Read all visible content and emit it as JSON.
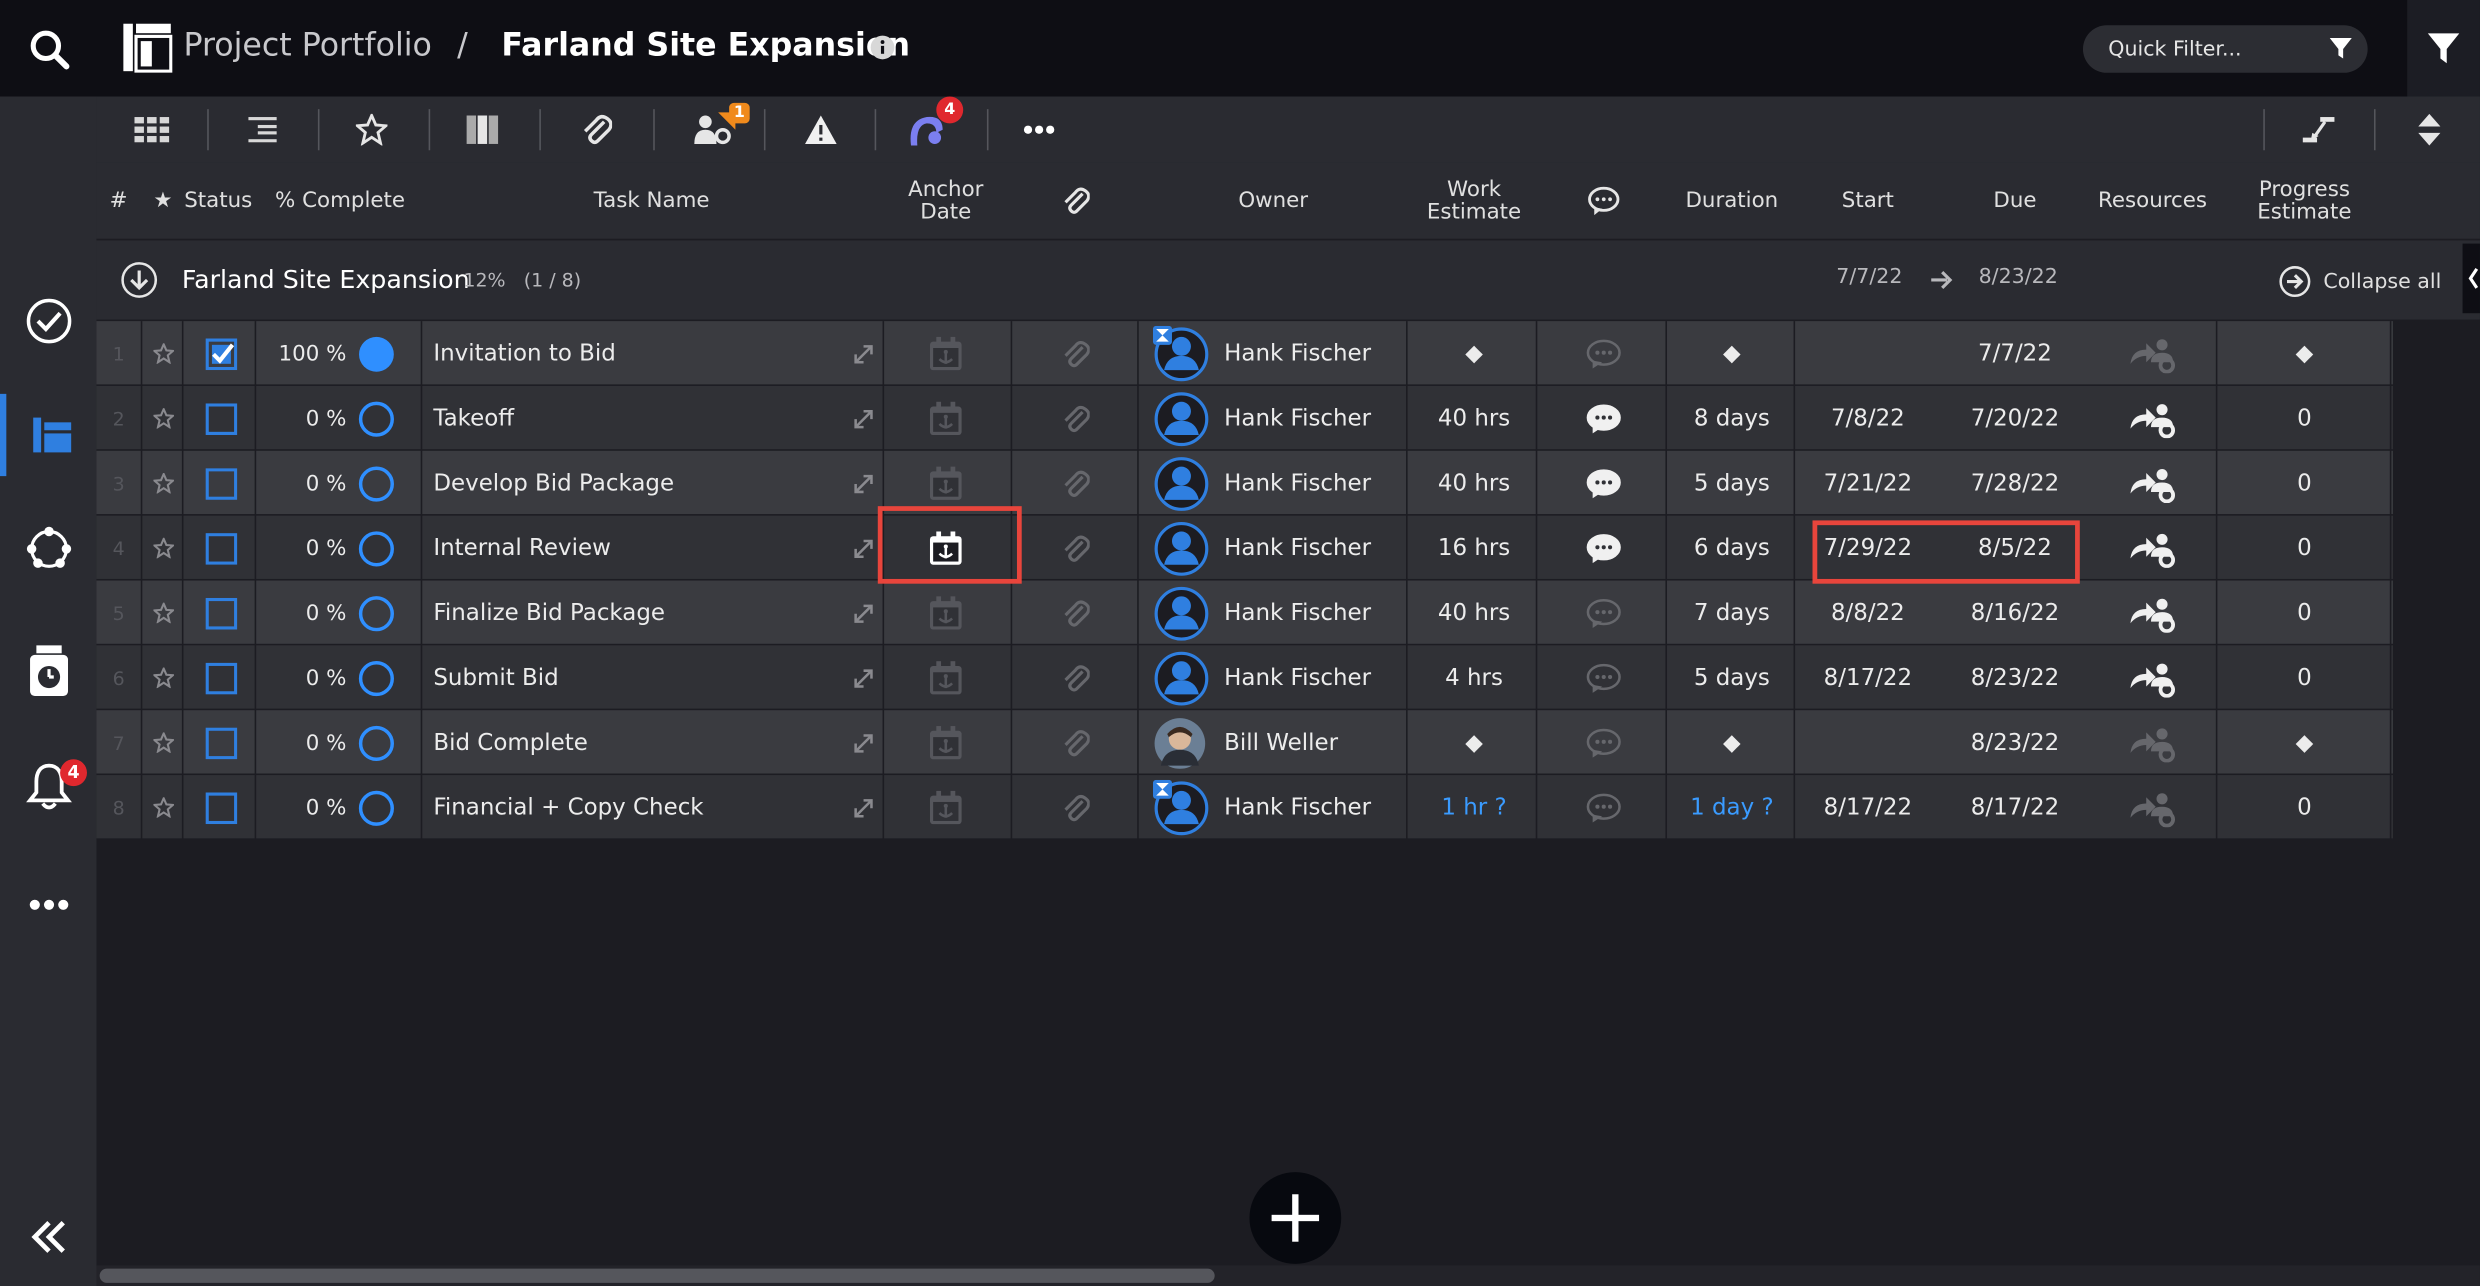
{
  "header": {
    "breadcrumb_root": "Project Portfolio",
    "breadcrumb_separator": "/",
    "title": "Farland Site Expansion",
    "quick_filter_placeholder": "Quick Filter..."
  },
  "rail": {
    "notification_count": "4"
  },
  "toolbar": {
    "resource_badge": "1",
    "collab_badge": "4"
  },
  "columns": {
    "num": "#",
    "star": "★",
    "status": "Status",
    "pct": "% Complete",
    "task": "Task Name",
    "anchor_line1": "Anchor",
    "anchor_line2": "Date",
    "owner": "Owner",
    "work_line1": "Work",
    "work_line2": "Estimate",
    "duration": "Duration",
    "start": "Start",
    "due": "Due",
    "resources": "Resources",
    "progress_line1": "Progress",
    "progress_line2": "Estimate"
  },
  "group": {
    "title": "Farland Site Expansion",
    "meta": "12%   (1 / 8)",
    "start": "7/7/22",
    "due": "8/23/22",
    "collapse_label": "Collapse all"
  },
  "rows": [
    {
      "num": "1",
      "checked": true,
      "pct": "100 %",
      "filled": true,
      "task": "Invitation to Bid",
      "owner": "Hank Fischer",
      "avatar": "timer-person",
      "work": "◆",
      "comment_active": false,
      "duration": "◆",
      "start": "",
      "due": "7/7/22",
      "res_active": false,
      "progress": "◆"
    },
    {
      "num": "2",
      "checked": false,
      "pct": "0 %",
      "filled": false,
      "task": "Takeoff",
      "owner": "Hank Fischer",
      "avatar": "person",
      "work": "40 hrs",
      "comment_active": true,
      "duration": "8 days",
      "start": "7/8/22",
      "due": "7/20/22",
      "res_active": true,
      "progress": "0"
    },
    {
      "num": "3",
      "checked": false,
      "pct": "0 %",
      "filled": false,
      "task": "Develop Bid Package",
      "owner": "Hank Fischer",
      "avatar": "person",
      "work": "40 hrs",
      "comment_active": true,
      "duration": "5 days",
      "start": "7/21/22",
      "due": "7/28/22",
      "res_active": true,
      "progress": "0"
    },
    {
      "num": "4",
      "checked": false,
      "pct": "0 %",
      "filled": false,
      "task": "Internal Review",
      "owner": "Hank Fischer",
      "avatar": "person",
      "work": "16 hrs",
      "comment_active": true,
      "duration": "6 days",
      "start": "7/29/22",
      "due": "8/5/22",
      "res_active": true,
      "progress": "0",
      "anchor_active": true
    },
    {
      "num": "5",
      "checked": false,
      "pct": "0 %",
      "filled": false,
      "task": "Finalize Bid Package",
      "owner": "Hank Fischer",
      "avatar": "person",
      "work": "40 hrs",
      "comment_active": false,
      "duration": "7 days",
      "start": "8/8/22",
      "due": "8/16/22",
      "res_active": true,
      "progress": "0"
    },
    {
      "num": "6",
      "checked": false,
      "pct": "0 %",
      "filled": false,
      "task": "Submit Bid",
      "owner": "Hank Fischer",
      "avatar": "person",
      "work": "4 hrs",
      "comment_active": false,
      "duration": "5 days",
      "start": "8/17/22",
      "due": "8/23/22",
      "res_active": true,
      "progress": "0"
    },
    {
      "num": "7",
      "checked": false,
      "pct": "0 %",
      "filled": false,
      "task": "Bid Complete",
      "owner": "Bill Weller",
      "avatar": "photo",
      "work": "◆",
      "comment_active": false,
      "duration": "◆",
      "start": "",
      "due": "8/23/22",
      "res_active": false,
      "progress": "◆"
    },
    {
      "num": "8",
      "checked": false,
      "pct": "0 %",
      "filled": false,
      "task": "Financial + Copy Check",
      "owner": "Hank Fischer",
      "avatar": "timer-person",
      "work": "1 hr ?",
      "work_blue": true,
      "comment_active": false,
      "duration": "1 day ?",
      "duration_blue": true,
      "start": "8/17/22",
      "due": "8/17/22",
      "res_active": false,
      "progress": "0"
    }
  ]
}
